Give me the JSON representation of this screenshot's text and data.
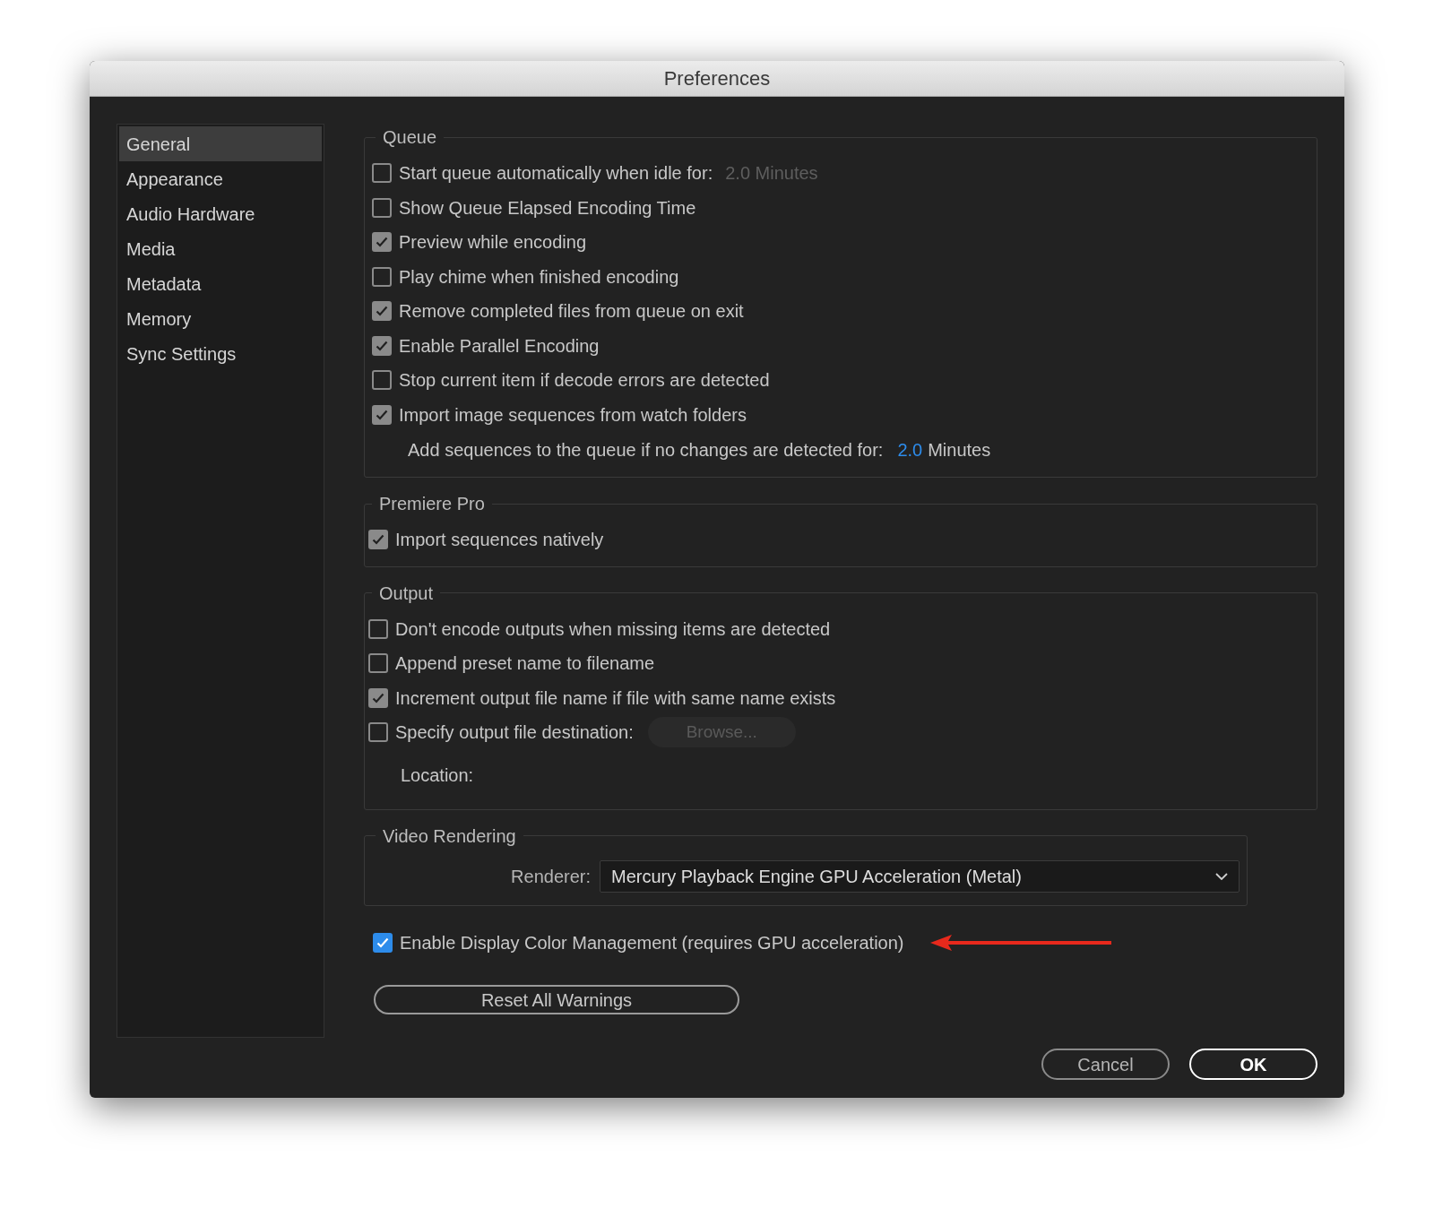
{
  "window": {
    "title": "Preferences"
  },
  "sidebar": {
    "items": [
      {
        "label": "General",
        "selected": true
      },
      {
        "label": "Appearance",
        "selected": false
      },
      {
        "label": "Audio Hardware",
        "selected": false
      },
      {
        "label": "Media",
        "selected": false
      },
      {
        "label": "Metadata",
        "selected": false
      },
      {
        "label": "Memory",
        "selected": false
      },
      {
        "label": "Sync Settings",
        "selected": false
      }
    ]
  },
  "queue": {
    "title": "Queue",
    "items": [
      {
        "label": "Start queue automatically when idle for:",
        "checked": false,
        "value": {
          "text": "2.0 Minutes",
          "disabled": true
        }
      },
      {
        "label": "Show Queue Elapsed Encoding Time",
        "checked": false
      },
      {
        "label": "Preview while encoding",
        "checked": true
      },
      {
        "label": "Play chime when finished encoding",
        "checked": false
      },
      {
        "label": "Remove completed files from queue on exit",
        "checked": true
      },
      {
        "label": "Enable Parallel Encoding",
        "checked": true
      },
      {
        "label": "Stop current item if decode errors are detected",
        "checked": false
      },
      {
        "label": "Import image sequences from watch folders",
        "checked": true
      }
    ],
    "delay": {
      "label": "Add sequences to the queue if no changes are detected for:",
      "value": "2.0",
      "unit": "Minutes"
    }
  },
  "premiere_pro": {
    "title": "Premiere Pro",
    "items": [
      {
        "label": "Import sequences natively",
        "checked": true
      }
    ]
  },
  "output": {
    "title": "Output",
    "items": [
      {
        "label": "Don't encode outputs when missing items are detected",
        "checked": false
      },
      {
        "label": "Append preset name to filename",
        "checked": false
      },
      {
        "label": "Increment output file name if file with same name exists",
        "checked": true
      },
      {
        "label": "Specify output file destination:",
        "checked": false,
        "button": {
          "label": "Browse...",
          "disabled": true
        }
      }
    ],
    "location_label": "Location:"
  },
  "video_rendering": {
    "title": "Video Rendering",
    "renderer_label": "Renderer:",
    "renderer_value": "Mercury Playback Engine GPU Acceleration (Metal)"
  },
  "color_management": {
    "label": "Enable Display Color Management (requires GPU acceleration)",
    "checked": true,
    "focused": true
  },
  "reset_button": "Reset All Warnings",
  "buttons": [
    {
      "label": "Cancel",
      "default": false
    },
    {
      "label": "OK",
      "default": true
    }
  ]
}
